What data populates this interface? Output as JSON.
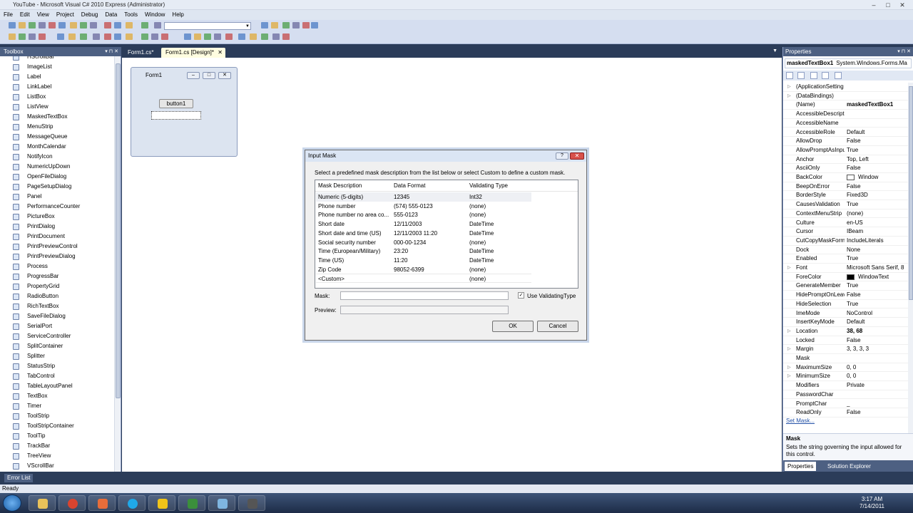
{
  "window": {
    "title": "YouTube - Microsoft Visual C# 2010 Express (Administrator)"
  },
  "menu": [
    "File",
    "Edit",
    "View",
    "Project",
    "Debug",
    "Data",
    "Tools",
    "Window",
    "Help"
  ],
  "toolbox": {
    "title": "Toolbox",
    "items": [
      "HScrollBar",
      "ImageList",
      "Label",
      "LinkLabel",
      "ListBox",
      "ListView",
      "MaskedTextBox",
      "MenuStrip",
      "MessageQueue",
      "MonthCalendar",
      "NotifyIcon",
      "NumericUpDown",
      "OpenFileDialog",
      "PageSetupDialog",
      "Panel",
      "PerformanceCounter",
      "PictureBox",
      "PrintDialog",
      "PrintDocument",
      "PrintPreviewControl",
      "PrintPreviewDialog",
      "Process",
      "ProgressBar",
      "PropertyGrid",
      "RadioButton",
      "RichTextBox",
      "SaveFileDialog",
      "SerialPort",
      "ServiceController",
      "SplitContainer",
      "Splitter",
      "StatusStrip",
      "TabControl",
      "TableLayoutPanel",
      "TextBox",
      "Timer",
      "ToolStrip",
      "ToolStripContainer",
      "ToolTip",
      "TrackBar",
      "TreeView",
      "VScrollBar"
    ]
  },
  "tabs": [
    {
      "label": "Form1.cs*"
    },
    {
      "label": "Form1.cs [Design]*"
    }
  ],
  "designer": {
    "form_title": "Form1",
    "button_label": "button1"
  },
  "dialog": {
    "title": "Input Mask",
    "instruction": "Select a predefined mask description from the list below or select Custom to define a custom mask.",
    "columns": [
      "Mask Description",
      "Data Format",
      "Validating Type"
    ],
    "rows": [
      [
        "Numeric (5-digits)",
        "12345",
        "Int32"
      ],
      [
        "Phone number",
        "(574) 555-0123",
        "(none)"
      ],
      [
        "Phone number no area co...",
        "555-0123",
        "(none)"
      ],
      [
        "Short date",
        "12/11/2003",
        "DateTime"
      ],
      [
        "Short date and time (US)",
        "12/11/2003 11:20",
        "DateTime"
      ],
      [
        "Social security number",
        "000-00-1234",
        "(none)"
      ],
      [
        "Time (European/Military)",
        "23:20",
        "DateTime"
      ],
      [
        "Time (US)",
        "11:20",
        "DateTime"
      ],
      [
        "Zip Code",
        "98052-6399",
        "(none)"
      ],
      [
        "<Custom>",
        "",
        "(none)"
      ]
    ],
    "mask_label": "Mask:",
    "preview_label": "Preview:",
    "mask_value": "",
    "preview_value": "",
    "use_validating_label": "Use ValidatingType",
    "use_validating_checked": true,
    "ok_label": "OK",
    "cancel_label": "Cancel"
  },
  "properties": {
    "title": "Properties",
    "object_name": "maskedTextBox1",
    "object_type": "System.Windows.Forms.Ma",
    "rows": [
      {
        "name": "(ApplicationSetting",
        "value": "",
        "expand": true
      },
      {
        "name": "(DataBindings)",
        "value": "",
        "expand": true
      },
      {
        "name": "(Name)",
        "value": "maskedTextBox1",
        "bold": true
      },
      {
        "name": "AccessibleDescripti",
        "value": ""
      },
      {
        "name": "AccessibleName",
        "value": ""
      },
      {
        "name": "AccessibleRole",
        "value": "Default"
      },
      {
        "name": "AllowDrop",
        "value": "False"
      },
      {
        "name": "AllowPromptAsInput",
        "value": "True"
      },
      {
        "name": "Anchor",
        "value": "Top, Left"
      },
      {
        "name": "AsciiOnly",
        "value": "False"
      },
      {
        "name": "BackColor",
        "value": "Window",
        "swatch": "#ffffff"
      },
      {
        "name": "BeepOnError",
        "value": "False"
      },
      {
        "name": "BorderStyle",
        "value": "Fixed3D"
      },
      {
        "name": "CausesValidation",
        "value": "True"
      },
      {
        "name": "ContextMenuStrip",
        "value": "(none)"
      },
      {
        "name": "Culture",
        "value": "en-US"
      },
      {
        "name": "Cursor",
        "value": "IBeam"
      },
      {
        "name": "CutCopyMaskForm",
        "value": "IncludeLiterals"
      },
      {
        "name": "Dock",
        "value": "None"
      },
      {
        "name": "Enabled",
        "value": "True"
      },
      {
        "name": "Font",
        "value": "Microsoft Sans Serif, 8",
        "expand": true
      },
      {
        "name": "ForeColor",
        "value": "WindowText",
        "swatch": "#000000"
      },
      {
        "name": "GenerateMember",
        "value": "True"
      },
      {
        "name": "HidePromptOnLeav",
        "value": "False"
      },
      {
        "name": "HideSelection",
        "value": "True"
      },
      {
        "name": "ImeMode",
        "value": "NoControl"
      },
      {
        "name": "InsertKeyMode",
        "value": "Default"
      },
      {
        "name": "Location",
        "value": "38, 68",
        "expand": true,
        "bold": true
      },
      {
        "name": "Locked",
        "value": "False"
      },
      {
        "name": "Margin",
        "value": "3, 3, 3, 3",
        "expand": true
      },
      {
        "name": "Mask",
        "value": ""
      },
      {
        "name": "MaximumSize",
        "value": "0, 0",
        "expand": true
      },
      {
        "name": "MinimumSize",
        "value": "0, 0",
        "expand": true
      },
      {
        "name": "Modifiers",
        "value": "Private"
      },
      {
        "name": "PasswordChar",
        "value": ""
      },
      {
        "name": "PromptChar",
        "value": "_"
      },
      {
        "name": "ReadOnly",
        "value": "False"
      }
    ],
    "set_mask_link": "Set Mask...",
    "desc_title": "Mask",
    "desc_body": "Sets the string governing the input allowed for this control.",
    "tab_properties": "Properties",
    "tab_solution": "Solution Explorer"
  },
  "error_list": "Error List",
  "status": "Ready",
  "clock": {
    "time": "3:17 AM",
    "date": "7/14/2011"
  },
  "colors": {
    "ide_bg": "#2b3c59",
    "panel_header": "#4d6082",
    "tab_active": "#fffde0"
  }
}
